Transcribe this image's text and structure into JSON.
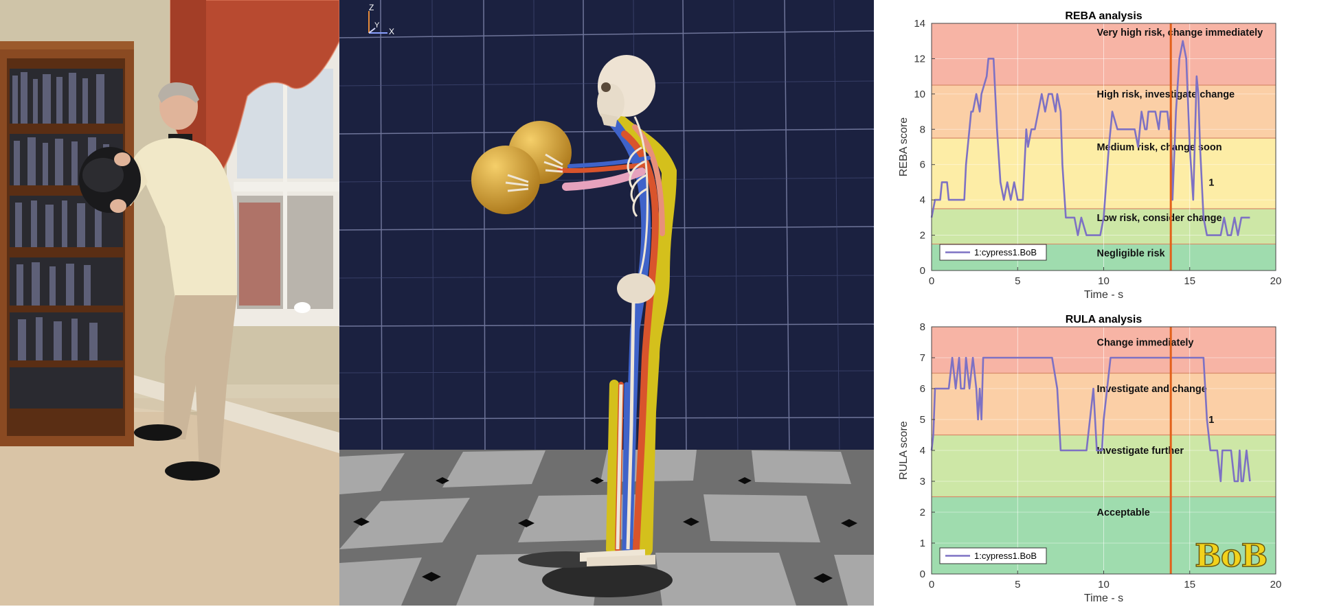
{
  "colors": {
    "red_zone": "#f7b4a5",
    "orange_zone": "#fbcfa6",
    "yellow_zone": "#fdeda6",
    "lightgreen_zone": "#cde7a6",
    "green_zone": "#9fdcae",
    "series": "#7d71c4",
    "time_cursor": "#e2611a",
    "zone_border": "#d88b6a",
    "logo": "#f2d21c"
  },
  "icons": {
    "axes_gizmo": "xyz-axes-icon",
    "logo": "bob-logo"
  },
  "sim": {
    "axis_z": "Z",
    "axis_y": "Y",
    "axis_x": "X"
  },
  "logo_text": "BoB",
  "chart_data": [
    {
      "type": "line",
      "title": "REBA analysis",
      "xlabel": "Time - s",
      "ylabel": "REBA score",
      "xlim": [
        0,
        20
      ],
      "ylim": [
        0,
        14
      ],
      "xticks": [
        0,
        5,
        10,
        15,
        20
      ],
      "yticks": [
        0,
        2,
        4,
        6,
        8,
        10,
        12,
        14
      ],
      "cursor_x": 13.9,
      "legend": {
        "position": "bottom-left",
        "entries": [
          "1:cypress1.BoB"
        ]
      },
      "marker_label": {
        "text": "1",
        "x": 16.1,
        "y": 5
      },
      "zones": [
        {
          "from": 0,
          "to": 1.5,
          "color_key": "green_zone",
          "label": "Negligible risk",
          "label_y": 1
        },
        {
          "from": 1.5,
          "to": 3.5,
          "color_key": "lightgreen_zone",
          "label": "Low risk, consider change",
          "label_y": 3
        },
        {
          "from": 3.5,
          "to": 7.5,
          "color_key": "yellow_zone",
          "label": "Medium risk, change soon",
          "label_y": 7
        },
        {
          "from": 7.5,
          "to": 10.5,
          "color_key": "orange_zone",
          "label": "High risk, investigate change",
          "label_y": 10
        },
        {
          "from": 10.5,
          "to": 14,
          "color_key": "red_zone",
          "label": "Very high risk, change immediately",
          "label_y": 13.5
        }
      ],
      "series": [
        {
          "name": "1:cypress1.BoB",
          "x": [
            0,
            0.1,
            0.2,
            0.5,
            0.6,
            0.9,
            1.0,
            1.5,
            1.9,
            2.0,
            2.3,
            2.4,
            2.6,
            2.8,
            2.9,
            3.2,
            3.3,
            3.6,
            3.8,
            4.0,
            4.2,
            4.4,
            4.6,
            4.8,
            5.0,
            5.2,
            5.3,
            5.4,
            5.5,
            5.6,
            5.8,
            6.0,
            6.2,
            6.4,
            6.6,
            6.8,
            7.0,
            7.2,
            7.3,
            7.5,
            7.6,
            7.8,
            7.9,
            8.1,
            8.3,
            8.5,
            8.7,
            9.0,
            9.3,
            9.6,
            9.8,
            10.0,
            10.3,
            10.5,
            10.8,
            11.2,
            11.5,
            11.8,
            12.0,
            12.2,
            12.4,
            12.5,
            12.6,
            12.8,
            13.0,
            13.2,
            13.3,
            13.5,
            13.7,
            13.8,
            13.9,
            14.0,
            14.2,
            14.4,
            14.6,
            14.8,
            15.0,
            15.2,
            15.4,
            15.5,
            15.6,
            15.8,
            16.0,
            16.2,
            16.5,
            16.8,
            17.0,
            17.2,
            17.4,
            17.6,
            17.8,
            18.0,
            18.3,
            18.5
          ],
          "y": [
            3,
            3.5,
            4,
            4,
            5,
            5,
            4,
            4,
            4,
            6,
            9,
            9,
            10,
            9,
            10,
            11,
            12,
            12,
            8,
            5,
            4,
            5,
            4,
            5,
            4,
            4,
            4,
            6,
            8,
            7,
            8,
            8,
            9,
            10,
            9,
            10,
            10,
            9,
            10,
            9,
            6,
            3,
            3,
            3,
            3,
            2,
            3,
            2,
            2,
            2,
            2,
            3,
            7,
            9,
            8,
            8,
            8,
            8,
            7,
            9,
            8,
            8,
            9,
            9,
            9,
            8,
            9,
            9,
            9,
            8,
            9,
            4,
            9,
            12,
            13,
            12,
            7,
            4,
            11,
            10,
            7,
            3,
            2,
            2,
            2,
            2,
            3,
            2,
            2,
            3,
            2,
            3,
            3,
            3
          ]
        }
      ]
    },
    {
      "type": "line",
      "title": "RULA analysis",
      "xlabel": "Time - s",
      "ylabel": "RULA score",
      "xlim": [
        0,
        20
      ],
      "ylim": [
        0,
        8
      ],
      "xticks": [
        0,
        5,
        10,
        15,
        20
      ],
      "yticks": [
        0,
        1,
        2,
        3,
        4,
        5,
        6,
        7,
        8
      ],
      "cursor_x": 13.9,
      "legend": {
        "position": "bottom-left",
        "entries": [
          "1:cypress1.BoB"
        ]
      },
      "marker_label": {
        "text": "1",
        "x": 16.1,
        "y": 5
      },
      "zones": [
        {
          "from": 0,
          "to": 2.5,
          "color_key": "green_zone",
          "label": "Acceptable",
          "label_y": 2
        },
        {
          "from": 2.5,
          "to": 4.5,
          "color_key": "lightgreen_zone",
          "label": "Investigate further",
          "label_y": 4
        },
        {
          "from": 4.5,
          "to": 6.5,
          "color_key": "orange_zone",
          "label": "Investigate and change",
          "label_y": 6
        },
        {
          "from": 6.5,
          "to": 8,
          "color_key": "red_zone",
          "label": "Change immediately",
          "label_y": 7.5
        }
      ],
      "series": [
        {
          "name": "1:cypress1.BoB",
          "x": [
            0,
            0.1,
            0.2,
            0.6,
            1.0,
            1.2,
            1.4,
            1.6,
            1.7,
            1.9,
            2.0,
            2.2,
            2.4,
            2.6,
            2.7,
            2.8,
            2.9,
            3.0,
            3.1,
            3.2,
            3.3,
            3.5,
            4.0,
            5.0,
            6.0,
            7.0,
            7.3,
            7.5,
            7.7,
            8.0,
            9.0,
            9.2,
            9.4,
            9.6,
            9.8,
            9.9,
            10.0,
            10.2,
            10.4,
            10.5,
            12.0,
            13.0,
            14.0,
            15.0,
            15.8,
            16.0,
            16.2,
            16.4,
            16.6,
            16.8,
            16.9,
            17.0,
            17.2,
            17.4,
            17.6,
            17.8,
            17.9,
            18.0,
            18.1,
            18.3,
            18.5
          ],
          "y": [
            4,
            4.5,
            6,
            6,
            6,
            7,
            6,
            7,
            6,
            6,
            7,
            6,
            7,
            6,
            5,
            6,
            5,
            7,
            7,
            7,
            7,
            7,
            7,
            7,
            7,
            7,
            6,
            4,
            4,
            4,
            4,
            5,
            6,
            4,
            4,
            4,
            5,
            6,
            7,
            7,
            7,
            7,
            7,
            7,
            7,
            5,
            4,
            4,
            4,
            3,
            4,
            4,
            4,
            4,
            3,
            3,
            4,
            3,
            3,
            4,
            3
          ]
        }
      ]
    }
  ]
}
